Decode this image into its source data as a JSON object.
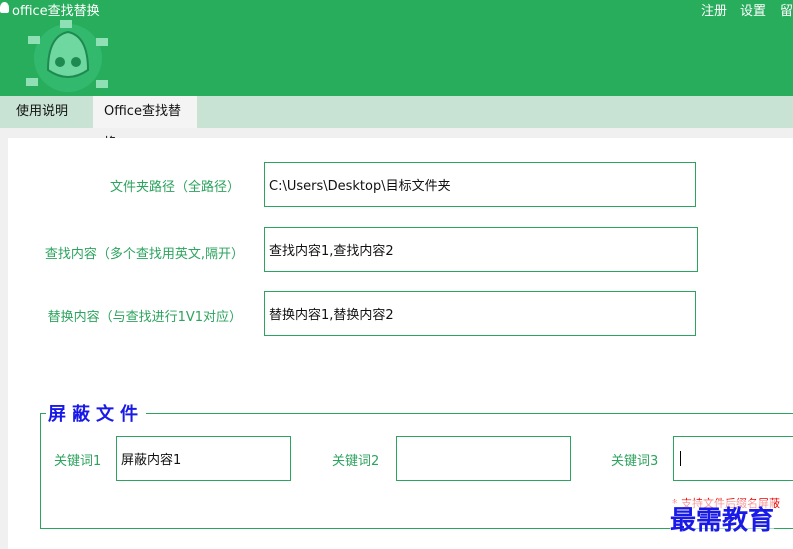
{
  "window": {
    "title": "office查找替换",
    "top_buttons": [
      "注册",
      "设置",
      "留"
    ]
  },
  "tabs": [
    {
      "label": "使用说明",
      "active": false
    },
    {
      "label": "Office查找替换",
      "active": true
    }
  ],
  "form": {
    "folder": {
      "label": "文件夹路径（全路径）",
      "value": "C:\\Users\\Desktop\\目标文件夹"
    },
    "find": {
      "label": "查找内容（多个查找用英文,隔开）",
      "value": "查找内容1,查找内容2"
    },
    "replace": {
      "label": "替换内容（与查找进行1V1对应）",
      "value": "替换内容1,替换内容2"
    }
  },
  "shield": {
    "legend": "屏蔽文件",
    "keywords": [
      {
        "label": "关键词1",
        "value": "屏蔽内容1"
      },
      {
        "label": "关键词2",
        "value": ""
      },
      {
        "label": "关键词3",
        "value": ""
      }
    ],
    "note": "* 支持文件后缀名屏蔽"
  },
  "watermark": "最需教育",
  "colors": {
    "header": "#27ad5c",
    "accent": "#2ca35e",
    "legend": "#1a1ae8",
    "note": "#ee0000"
  }
}
